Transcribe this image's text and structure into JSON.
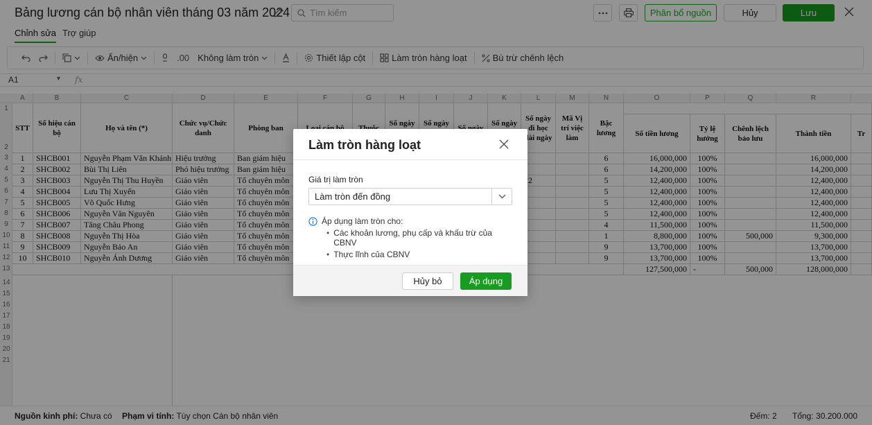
{
  "header": {
    "title": "Bảng lương cán bộ nhân viên tháng 03 năm 2024",
    "search_placeholder": "Tìm kiếm",
    "allocate_label": "Phân bổ nguồn",
    "cancel_label": "Hủy",
    "save_label": "Lưu"
  },
  "tabs": [
    {
      "label": "Chỉnh sửa",
      "active": true
    },
    {
      "label": "Trợ giúp",
      "active": false
    }
  ],
  "toolbar": {
    "show_hide": "Ẩn/hiện",
    "decimal_label": ".00",
    "rounding": "Không làm tròn",
    "column_setup": "Thiết lập cột",
    "batch_rounding": "Làm tròn hàng loạt",
    "offset_diff": "Bù trừ chênh lệch"
  },
  "formula_bar": {
    "cell_ref": "A1",
    "fx": "fx"
  },
  "grid": {
    "column_letters": [
      "A",
      "B",
      "C",
      "D",
      "E",
      "F",
      "G",
      "H",
      "I",
      "J",
      "K",
      "L",
      "M",
      "N",
      "O",
      "P",
      "Q",
      "R"
    ],
    "row_numbers": [
      "1",
      "2",
      "3",
      "4",
      "5",
      "6",
      "7",
      "8",
      "9",
      "10",
      "11",
      "12",
      "13",
      "14",
      "15",
      "16",
      "17",
      "18",
      "19",
      "20",
      "21"
    ],
    "headers": {
      "stt": "STT",
      "code": "Số hiệu cán bộ",
      "name": "Họ và tên (*)",
      "position": "Chức vụ/Chức danh",
      "department": "Phòng ban",
      "type": "Loại cán bộ",
      "belongs": "Thuộc",
      "workdays1": "Số ngày công",
      "workdays2": "Số ngày công",
      "days": "Số ngày",
      "leave": "Số ngày nghỉ",
      "study": "Số ngày đi học dài ngày",
      "job_code": "Mã Vị trí việc làm",
      "grade": "Bậc lương",
      "salary": "Số tiền lương",
      "ratio": "Tỷ lệ hưởng",
      "reserve": "Chênh lệch bảo lưu",
      "amount": "Thành tiền",
      "next": "Tr"
    },
    "rows": [
      {
        "stt": "1",
        "code": "SHCB001",
        "name": "Nguyễn Phạm Văn Khánh",
        "position": "Hiệu trưởng",
        "department": "Ban giám hiệu",
        "study": "",
        "grade": "6",
        "salary": "16,000,000",
        "ratio": "100%",
        "reserve": "",
        "amount": "16,000,000"
      },
      {
        "stt": "2",
        "code": "SHCB002",
        "name": "Bùi Thị Liên",
        "position": "Phó hiệu trưởng",
        "department": "Ban giám hiệu",
        "study": "",
        "grade": "6",
        "salary": "14,200,000",
        "ratio": "100%",
        "reserve": "",
        "amount": "14,200,000"
      },
      {
        "stt": "3",
        "code": "SHCB003",
        "name": "Nguyễn Thị Thu Huyền",
        "position": "Giáo viên",
        "department": "Tổ chuyên môn",
        "study": "22",
        "grade": "5",
        "salary": "12,400,000",
        "ratio": "100%",
        "reserve": "",
        "amount": "12,400,000"
      },
      {
        "stt": "4",
        "code": "SHCB004",
        "name": "Lưu Thị Xuyến",
        "position": "Giáo viên",
        "department": "Tổ chuyên môn",
        "study": "",
        "grade": "5",
        "salary": "12,400,000",
        "ratio": "100%",
        "reserve": "",
        "amount": "12,400,000"
      },
      {
        "stt": "5",
        "code": "SHCB005",
        "name": "Võ Quốc Hưng",
        "position": "Giáo viên",
        "department": "Tổ chuyên môn",
        "study": "",
        "grade": "5",
        "salary": "12,400,000",
        "ratio": "100%",
        "reserve": "",
        "amount": "12,400,000"
      },
      {
        "stt": "6",
        "code": "SHCB006",
        "name": "Nguyễn Văn Nguyên",
        "position": "Giáo viên",
        "department": "Tổ chuyên môn",
        "study": "",
        "grade": "5",
        "salary": "12,400,000",
        "ratio": "100%",
        "reserve": "",
        "amount": "12,400,000"
      },
      {
        "stt": "7",
        "code": "SHCB007",
        "name": "Tăng Châu Phong",
        "position": "Giáo viên",
        "department": "Tổ chuyên môn",
        "study": "",
        "grade": "4",
        "salary": "11,500,000",
        "ratio": "100%",
        "reserve": "",
        "amount": "11,500,000"
      },
      {
        "stt": "8",
        "code": "SHCB008",
        "name": "Nguyễn Thị Hòa",
        "position": "Giáo viên",
        "department": "Tổ chuyên môn",
        "study": "",
        "grade": "1",
        "salary": "8,800,000",
        "ratio": "100%",
        "reserve": "500,000",
        "amount": "9,300,000"
      },
      {
        "stt": "9",
        "code": "SHCB009",
        "name": "Nguyễn Bảo An",
        "position": "Giáo viên",
        "department": "Tổ chuyên môn",
        "study": "",
        "grade": "9",
        "salary": "13,700,000",
        "ratio": "100%",
        "reserve": "",
        "amount": "13,700,000"
      },
      {
        "stt": "10",
        "code": "SHCB010",
        "name": "Nguyễn Ánh Dương",
        "position": "Giáo viên",
        "department": "Tổ chuyên môn",
        "study": "",
        "grade": "9",
        "salary": "13,700,000",
        "ratio": "100%",
        "reserve": "",
        "amount": "13,700,000"
      }
    ],
    "totals": {
      "salary": "127,500,000",
      "ratio": "-",
      "reserve": "500,000",
      "amount": "128,000,000"
    }
  },
  "modal": {
    "title": "Làm tròn hàng loạt",
    "field_label": "Giá trị làm tròn",
    "field_value": "Làm tròn đến đồng",
    "info_title": "Áp dụng làm tròn cho:",
    "info_items": [
      "Các khoản lương, phụ cấp và khấu trừ của CBNV",
      "Thực lĩnh của CBNV"
    ],
    "dismiss_label": "Hủy bỏ",
    "apply_label": "Áp dụng"
  },
  "status": {
    "source_key": "Nguồn kinh phí:",
    "source_val": "Chưa có",
    "scope_key": "Phạm vi tính:",
    "scope_val": "Tùy chọn Cán bộ nhân viên",
    "count": "Đếm: 2",
    "total": "Tổng: 30.200.000"
  },
  "colors": {
    "accent": "#179c21",
    "accent_border": "#1da52a"
  }
}
